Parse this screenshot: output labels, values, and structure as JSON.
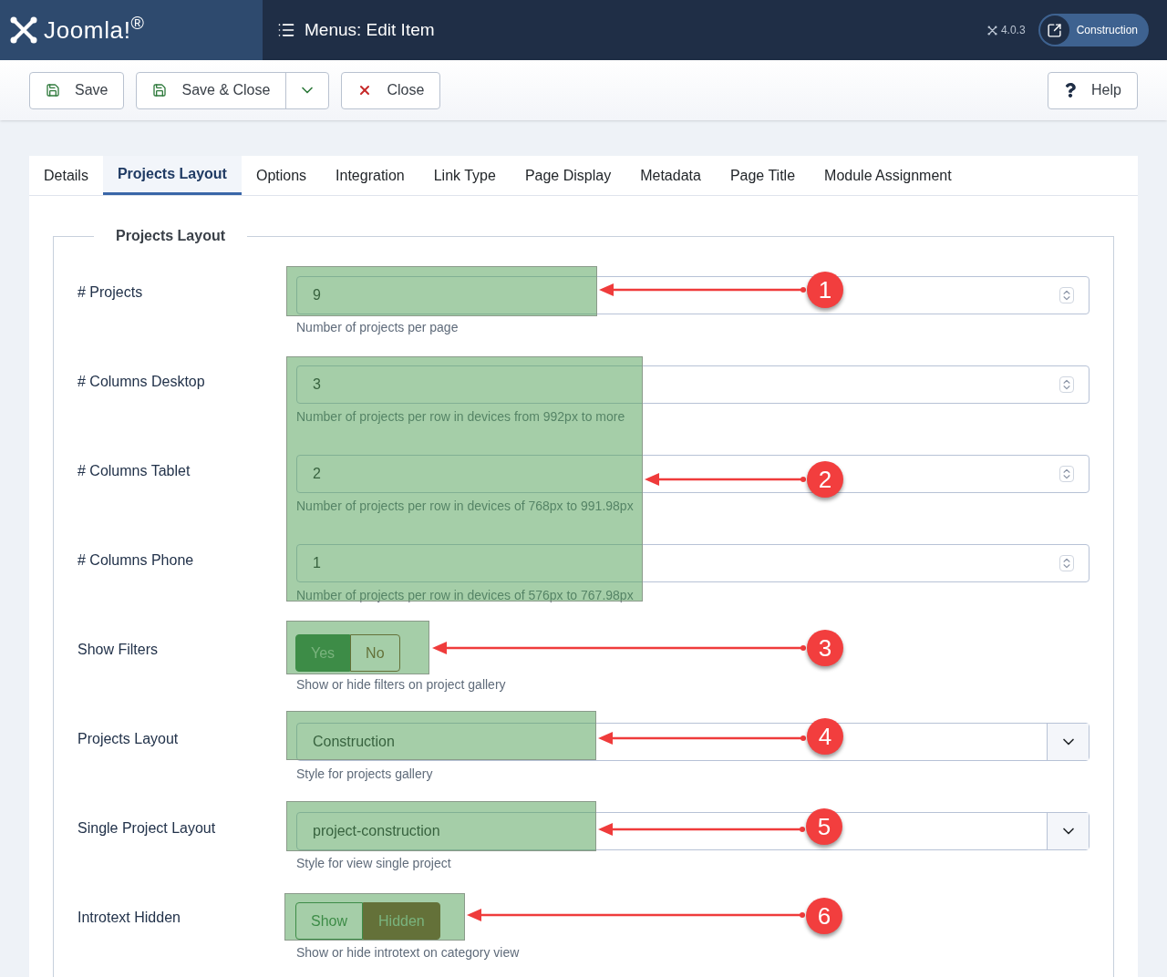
{
  "header": {
    "brand": "Joomla!$^{®}$",
    "title": "Menus: Edit Item",
    "version": "4.0.3",
    "site_button": "Construction"
  },
  "toolbar": {
    "save": "Save",
    "save_close": "Save & Close",
    "close": "Close",
    "help": "Help"
  },
  "tabs": [
    {
      "label": "Details",
      "selected": false
    },
    {
      "label": "Projects Layout",
      "selected": true
    },
    {
      "label": "Options",
      "selected": false
    },
    {
      "label": "Integration",
      "selected": false
    },
    {
      "label": "Link Type",
      "selected": false
    },
    {
      "label": "Page Display",
      "selected": false
    },
    {
      "label": "Metadata",
      "selected": false
    },
    {
      "label": "Page Title",
      "selected": false
    },
    {
      "label": "Module Assignment",
      "selected": false
    }
  ],
  "fieldset": {
    "legend": "Projects Layout",
    "fields": [
      {
        "kind": "number",
        "label": "# Projects",
        "value": "9",
        "hint": "Number of projects per page"
      },
      {
        "kind": "number",
        "label": "# Columns Desktop",
        "value": "3",
        "hint": "Number of projects per row in devices from 992px to more"
      },
      {
        "kind": "number",
        "label": "# Columns Tablet",
        "value": "2",
        "hint": "Number of projects per row in devices of 768px to 991.98px"
      },
      {
        "kind": "number",
        "label": "# Columns Phone",
        "value": "1",
        "hint": "Number of projects per row in devices of 576px to 767.98px"
      },
      {
        "kind": "toggle",
        "label": "Show Filters",
        "options": [
          {
            "label": "Yes",
            "selected": true
          },
          {
            "label": "No",
            "selected": false
          }
        ],
        "hint": "Show or hide filters on project gallery"
      },
      {
        "kind": "select",
        "label": "Projects Layout",
        "value": "Construction",
        "hint": "Style for projects gallery"
      },
      {
        "kind": "select",
        "label": "Single Project Layout",
        "value": "project-construction",
        "hint": "Style for view single project"
      },
      {
        "kind": "toggle",
        "label": "Introtext Hidden",
        "options": [
          {
            "label": "Show",
            "selected": false
          },
          {
            "label": "Hidden",
            "selected": true
          }
        ],
        "hint": "Show or hide introtext on category view"
      }
    ]
  },
  "annotations": [
    {
      "label": "1"
    },
    {
      "label": "2"
    },
    {
      "label": "3"
    },
    {
      "label": "4"
    },
    {
      "label": "5"
    },
    {
      "label": "6"
    }
  ]
}
